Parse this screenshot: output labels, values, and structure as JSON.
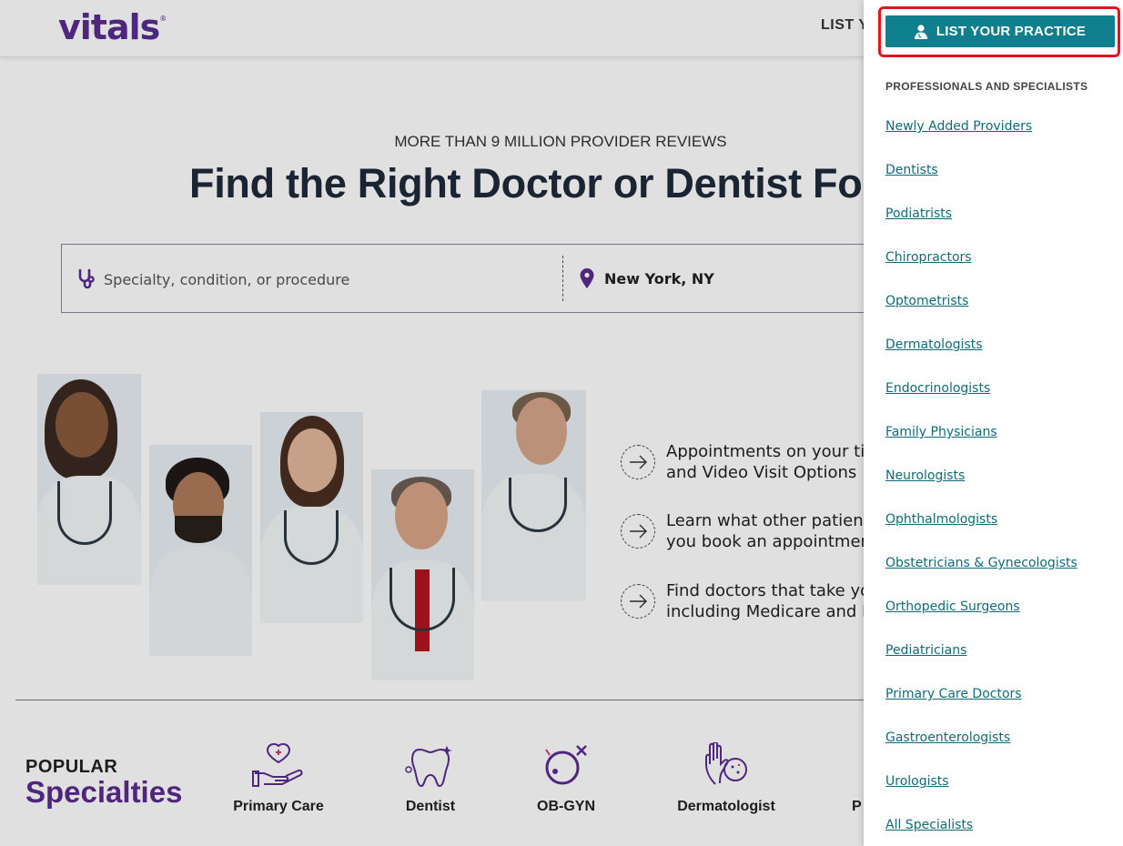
{
  "header": {
    "logo": "vitals",
    "logo_mark": "®",
    "nav_partial": "LIST Y"
  },
  "hero": {
    "eyebrow": "MORE THAN 9 MILLION PROVIDER REVIEWS",
    "headline": "Find the Right Doctor or Dentist For Y"
  },
  "search": {
    "placeholder": "Specialty, condition, or procedure",
    "location": "New York, NY"
  },
  "features": [
    {
      "line1": "Appointments on your tim",
      "line2": "and Video Visit Options"
    },
    {
      "line1": "Learn what other patient",
      "line2": "you book an appointmen"
    },
    {
      "line1": "Find doctors that take yo",
      "line2": "including Medicare and M"
    }
  ],
  "popular": {
    "kicker": "POPULAR",
    "title": "Specialties",
    "items": [
      {
        "label": "Primary Care",
        "icon": "hand-heart-icon"
      },
      {
        "label": "Dentist",
        "icon": "tooth-icon"
      },
      {
        "label": "OB-GYN",
        "icon": "female-symbol-icon"
      },
      {
        "label": "Dermatologist",
        "icon": "hand-skin-icon"
      },
      {
        "label": "P",
        "icon": "partial-icon"
      }
    ]
  },
  "drawer": {
    "cta_label": "LIST YOUR PRACTICE",
    "heading": "PROFESSIONALS AND SPECIALISTS",
    "links": [
      "Newly Added Providers",
      "Dentists",
      "Podiatrists",
      "Chiropractors",
      "Optometrists",
      "Dermatologists",
      "Endocrinologists",
      "Family Physicians",
      "Neurologists",
      "Ophthalmologists",
      "Obstetricians & Gynecologists",
      "Orthopedic Surgeons",
      "Pediatricians",
      "Primary Care Doctors",
      "Gastroenterologists",
      "Urologists",
      "All Specialists"
    ]
  },
  "colors": {
    "brand_purple": "#5b2c8f",
    "teal": "#0f7e8d",
    "link": "#0f6b78",
    "highlight_red": "#e5131e"
  }
}
